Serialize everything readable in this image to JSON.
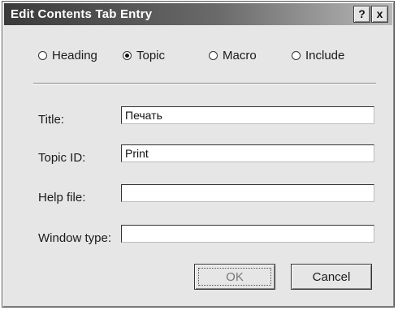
{
  "dialog": {
    "title": "Edit Contents Tab Entry",
    "help_button": "?",
    "close_button": "x"
  },
  "entry_type": {
    "options": [
      {
        "label": "Heading",
        "checked": false
      },
      {
        "label": "Topic",
        "checked": true
      },
      {
        "label": "Macro",
        "checked": false
      },
      {
        "label": "Include",
        "checked": false
      }
    ]
  },
  "fields": {
    "title": {
      "label": "Title:",
      "value": "Печать"
    },
    "topic_id": {
      "label": "Topic ID:",
      "value": "Print"
    },
    "help_file": {
      "label": "Help file:",
      "value": ""
    },
    "window_type": {
      "label": "Window type:",
      "value": ""
    }
  },
  "buttons": {
    "ok": "OK",
    "cancel": "Cancel"
  }
}
